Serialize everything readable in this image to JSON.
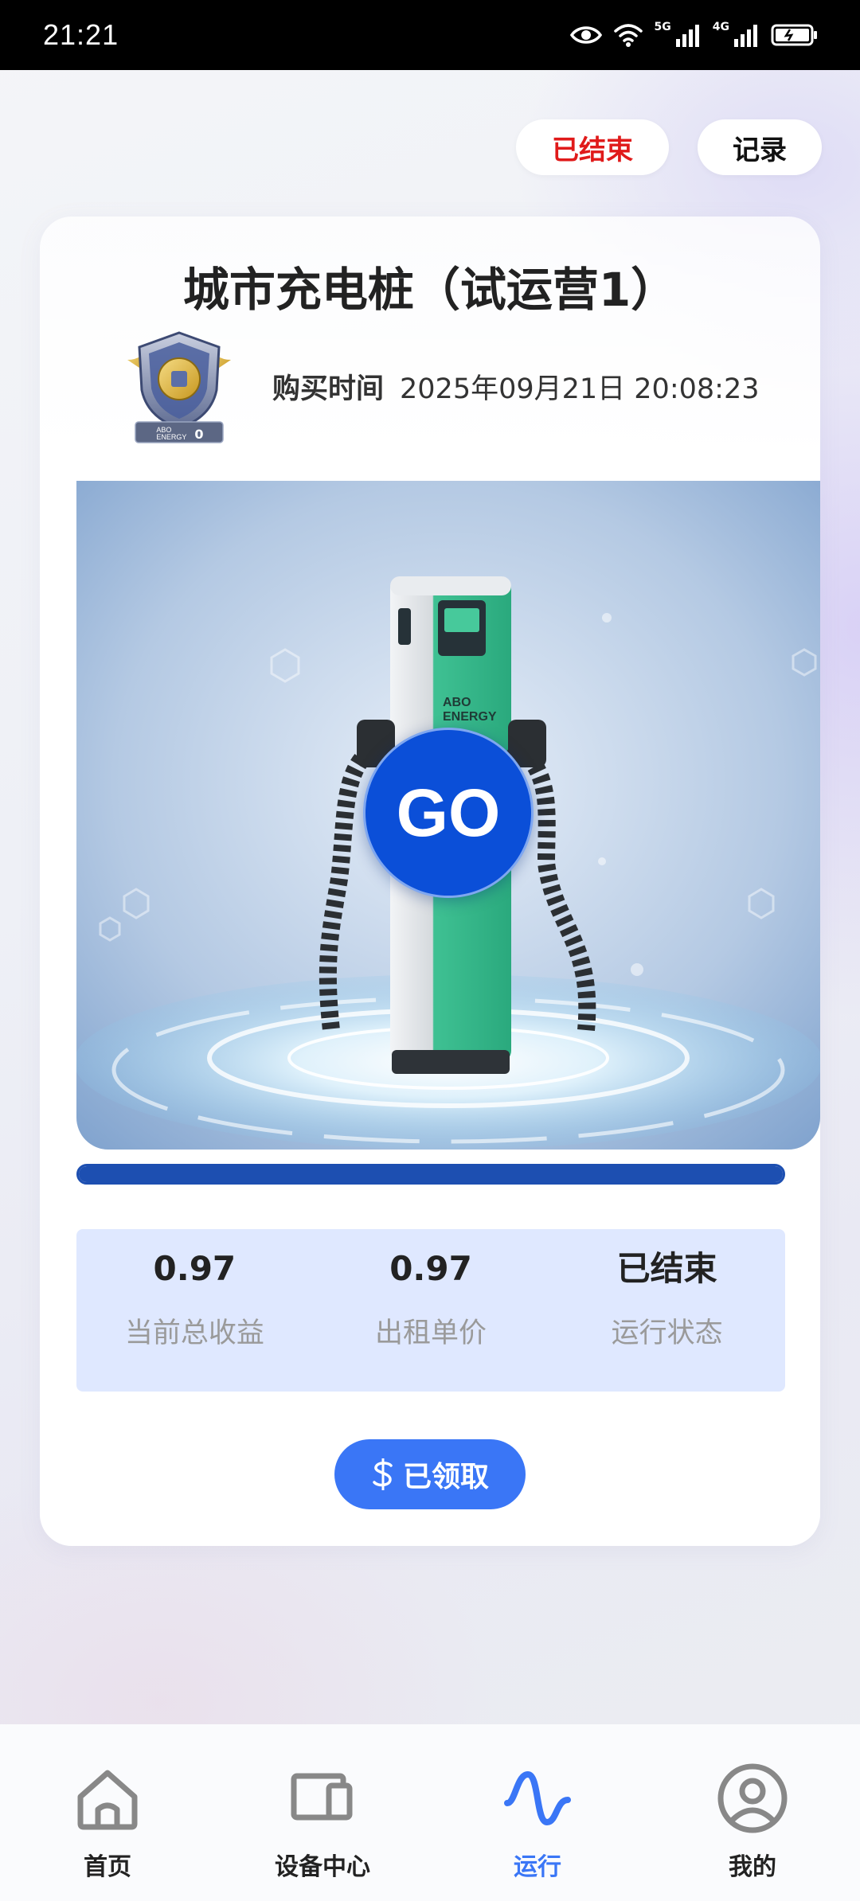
{
  "status_bar": {
    "time": "21:21",
    "network_5g": "5G",
    "network_4g": "4G",
    "icons": [
      "eye-icon",
      "wifi-icon",
      "signal-icon",
      "signal-icon",
      "battery-icon"
    ]
  },
  "header": {
    "status_button": "已结束",
    "record_button": "记录"
  },
  "card": {
    "title": "城市充电桩（试运营1）",
    "badge_text": "ABO ENERGY",
    "badge_level": "0",
    "purchase_label": "购买时间",
    "purchase_time": "2025年09月21日 20:08:23",
    "product_brand": "ABO ENERGY",
    "go_label": "GO",
    "progress": 1.0,
    "stats": [
      {
        "value": "0.97",
        "label": "当前总收益"
      },
      {
        "value": "0.97",
        "label": "出租单价"
      },
      {
        "value": "已结束",
        "label": "运行状态"
      }
    ],
    "claim_button": "已领取"
  },
  "tab_bar": {
    "items": [
      {
        "label": "首页",
        "icon": "home-icon",
        "active": false
      },
      {
        "label": "设备中心",
        "icon": "device-icon",
        "active": false
      },
      {
        "label": "运行",
        "icon": "wave-icon",
        "active": true
      },
      {
        "label": "我的",
        "icon": "user-icon",
        "active": false
      }
    ]
  },
  "colors": {
    "accent": "#3a76f6",
    "ended_red": "#e01a1a",
    "progress": "#1d4fb1",
    "stats_bg": "#dfe8ff"
  }
}
